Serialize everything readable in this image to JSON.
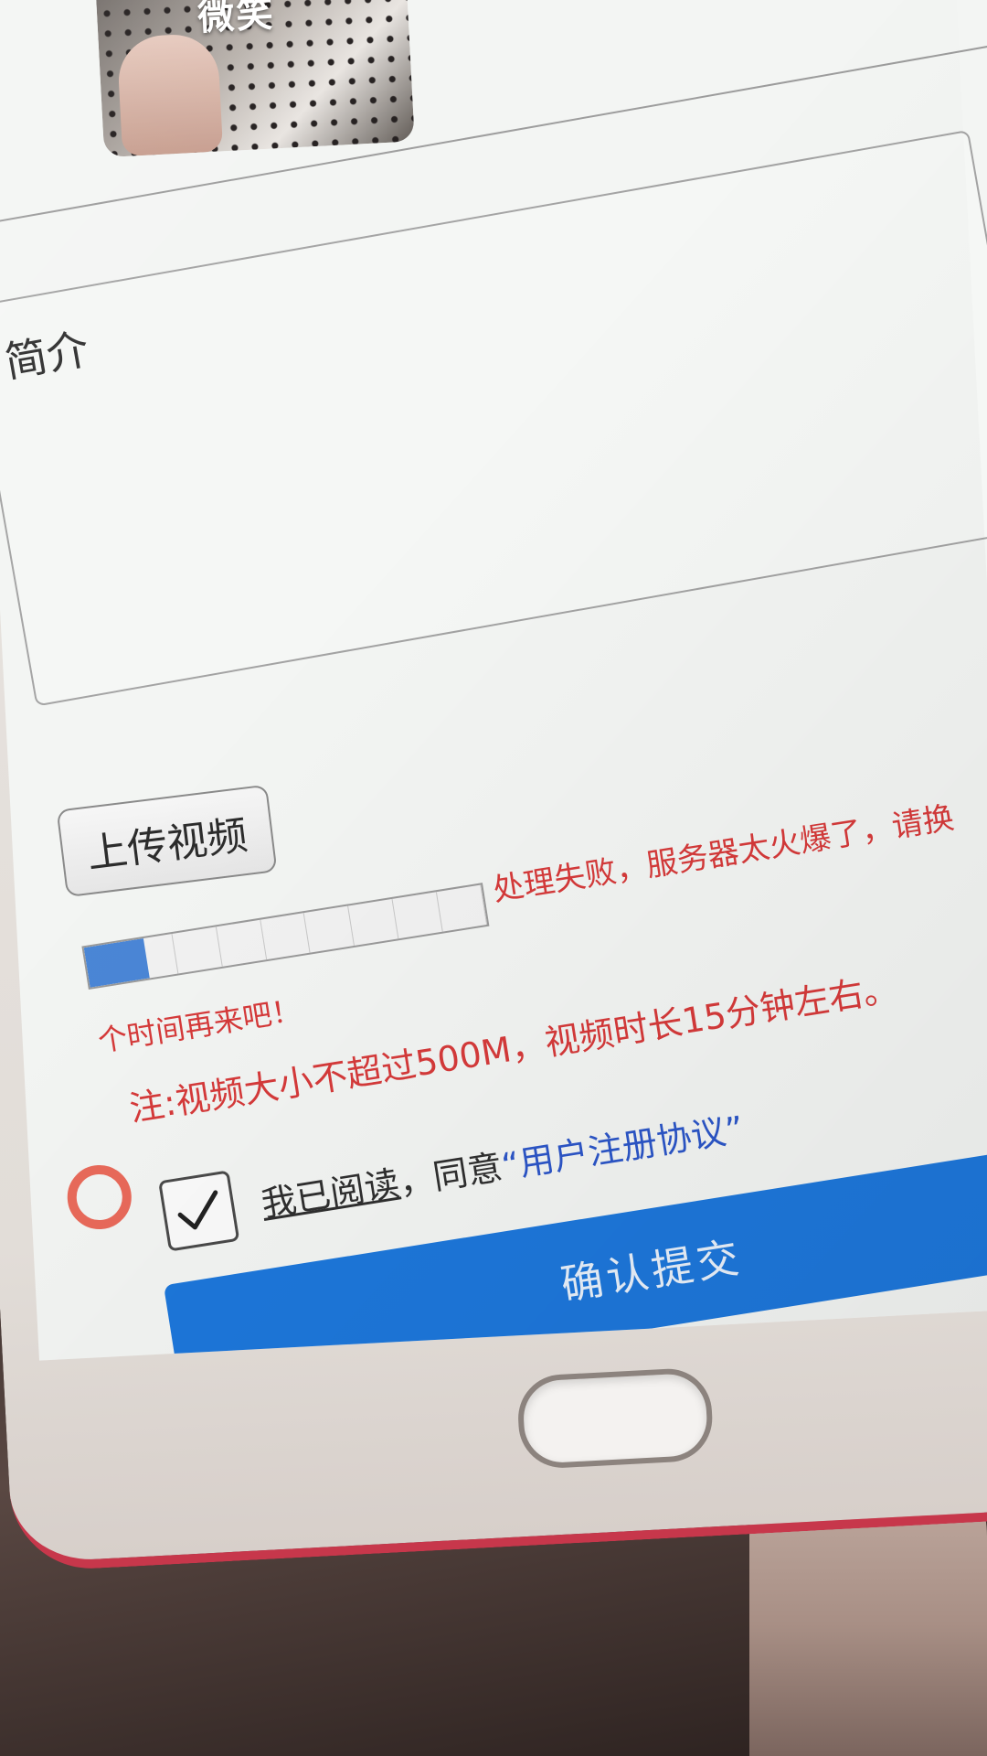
{
  "thumbnail": {
    "overlay_text": "微笑"
  },
  "form": {
    "description_label": "简介",
    "upload_button_label": "上传视频",
    "progress": {
      "fraction": 0.15,
      "error_line1": "处理失败，服务器太火爆了，请换",
      "error_line2": "个时间再来吧！"
    },
    "note": "注:视频大小不超过500M，视频时长15分钟左右。",
    "agree": {
      "checked": true,
      "read_text": "我已阅读",
      "middle_text": "，同意",
      "protocol_text": "“用户注册协议”"
    },
    "submit_label": "确认提交"
  },
  "colors": {
    "error": "#d63a3a",
    "primary_button": "#1d77db",
    "link": "#2c56c8",
    "progress_fill": "#4a86d6"
  },
  "icons": {
    "checkbox": "check-icon",
    "floating": "lifebuoy-icon"
  }
}
